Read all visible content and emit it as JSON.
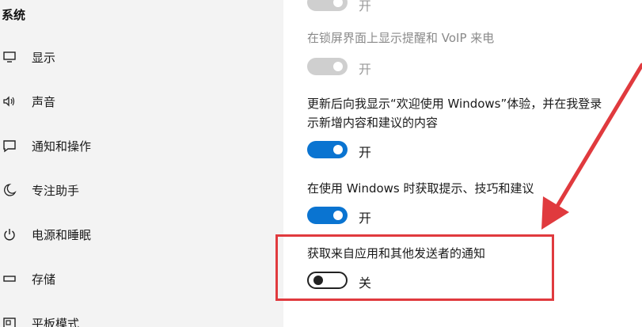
{
  "sidebar": {
    "title": "系统",
    "items": [
      {
        "label": "显示",
        "icon": "monitor-icon"
      },
      {
        "label": "声音",
        "icon": "speaker-icon"
      },
      {
        "label": "通知和操作",
        "icon": "notification-icon"
      },
      {
        "label": "专注助手",
        "icon": "moon-icon"
      },
      {
        "label": "电源和睡眠",
        "icon": "power-icon"
      },
      {
        "label": "存储",
        "icon": "storage-icon"
      },
      {
        "label": "平板模式",
        "icon": "tablet-icon"
      }
    ]
  },
  "main": {
    "settings": [
      {
        "text": "",
        "state": "开",
        "status": "disabled"
      },
      {
        "text": "在锁屏界面上显示提醒和 VoIP 来电",
        "state": "开",
        "status": "disabled"
      },
      {
        "text_line1": "更新后向我显示“欢迎使用 Windows”体验，并在我登录",
        "text_line2": "示新增内容和建议的内容",
        "state": "开",
        "status": "on"
      },
      {
        "text": "在使用 Windows 时获取提示、技巧和建议",
        "state": "开",
        "status": "on"
      },
      {
        "text": "获取来自应用和其他发送者的通知",
        "state": "关",
        "status": "off"
      }
    ]
  },
  "annotation": {
    "box_color": "#e03a3e",
    "arrow_color": "#e03a3e"
  },
  "colors": {
    "toggle_on": "#0a74d1",
    "toggle_disabled": "#cfcfcf",
    "sidebar_bg": "#f3f3f3"
  }
}
